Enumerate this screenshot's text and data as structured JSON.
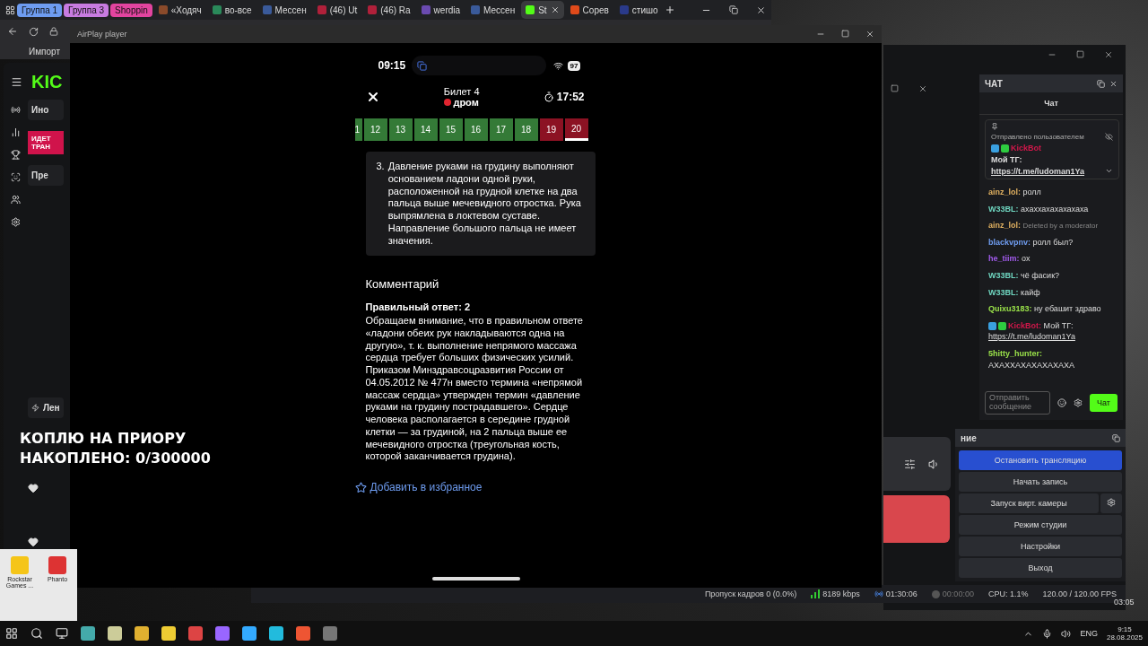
{
  "browser": {
    "tabs": [
      {
        "kind": "group",
        "label": "Группа 1",
        "color": "#6e9cf0"
      },
      {
        "kind": "group",
        "label": "Группа 3",
        "color": "#c77be0"
      },
      {
        "kind": "group",
        "label": "Shoppin",
        "color": "#e2449f"
      },
      {
        "kind": "page",
        "label": "«Ходяч",
        "selected": false
      },
      {
        "kind": "page",
        "label": "во-все",
        "selected": false
      },
      {
        "kind": "page",
        "label": "Мессен",
        "selected": false
      },
      {
        "kind": "page",
        "label": "(46) Ut",
        "selected": false
      },
      {
        "kind": "page",
        "label": "(46) Ra",
        "selected": false
      },
      {
        "kind": "page",
        "label": "werdia",
        "selected": false
      },
      {
        "kind": "page",
        "label": "Мессен",
        "selected": false
      },
      {
        "kind": "page",
        "label": "St",
        "selected": true
      },
      {
        "kind": "page",
        "label": "Сорев",
        "selected": false
      },
      {
        "kind": "page",
        "label": "стишо",
        "selected": false
      }
    ],
    "bookmark": "Импорт"
  },
  "kick_panel": {
    "logo": "KIC",
    "sections": [
      "Ино",
      "Пре",
      "Лен"
    ],
    "live_badge": [
      "ИДЕТ",
      "ТРАН"
    ]
  },
  "airplay": {
    "title": "AirPlay player",
    "phone": {
      "time": "09:15",
      "battery": "97",
      "ticket": "Билет 4",
      "brand": "дром",
      "timer": "17:52",
      "questions": [
        {
          "label": "1",
          "color": "#347a37",
          "selected": false
        },
        {
          "label": "12",
          "color": "#347a37",
          "selected": false
        },
        {
          "label": "13",
          "color": "#347a37",
          "selected": false
        },
        {
          "label": "14",
          "color": "#347a37",
          "selected": false
        },
        {
          "label": "15",
          "color": "#347a37",
          "selected": false
        },
        {
          "label": "16",
          "color": "#347a37",
          "selected": false
        },
        {
          "label": "17",
          "color": "#347a37",
          "selected": false
        },
        {
          "label": "18",
          "color": "#347a37",
          "selected": false
        },
        {
          "label": "19",
          "color": "#8c1223",
          "selected": false
        },
        {
          "label": "20",
          "color": "#8c1223",
          "selected": true
        }
      ],
      "option": {
        "number": "3.",
        "text": "Давление руками на грудину выполняют основанием ладони одной руки, расположенной на грудной клетке на два пальца выше мечевидного отростка. Рука выпрямлена в локтевом суставе. Направление большого пальца не имеет значения."
      },
      "comment_title": "Комментарий",
      "correct_answer": "Правильный ответ: 2",
      "comment": "Обращаем внимание, что в правильном ответе «ладони обеих рук накладываются одна на другую», т. к. выполнение непрямого массажа сердца требует больших физических усилий. Приказом Минздравсоцразвития России от 04.05.2012 № 477н вместо термина «непрямой массаж сердца» утвержден термин «давление руками на грудину пострадавшего». Сердце человека располагается в середине грудной клетки — за грудиной, на 2 пальца выше ее мечевидного отростка (треугольная кость, которой заканчивается грудина).",
      "favorite": "Добавить в избранное"
    }
  },
  "overlay": [
    "КОПЛЮ НА ПРИОРУ",
    "НАКОПЛЕНО: 0/300000"
  ],
  "chat": {
    "dock_title": "ЧАТ",
    "header": "Чат",
    "pinned": {
      "label": "Отправлено пользователем",
      "user": "KickBot",
      "text": "Мой ТГ:",
      "link": "https://t.me/ludoman1Ya"
    },
    "messages": [
      {
        "kind": "text",
        "user": "ainz_lol:",
        "color": "#e0b060",
        "text": "ролл"
      },
      {
        "kind": "text",
        "user": "W33BL:",
        "color": "#6fd6c0",
        "text": "ахаххахахахахаха"
      },
      {
        "kind": "deleted",
        "user": "ainz_lol:",
        "color": "#e0b060",
        "text": "Deleted by a moderator"
      },
      {
        "kind": "text",
        "user": "blackvpnv:",
        "color": "#6f9cf0",
        "text": "ролл был?"
      },
      {
        "kind": "text",
        "user": "he_tiim:",
        "color": "#a45cf0",
        "text": "ох"
      },
      {
        "kind": "text",
        "user": "W33BL:",
        "color": "#6fd6c0",
        "text": "чё фасик?"
      },
      {
        "kind": "text",
        "user": "W33BL:",
        "color": "#6fd6c0",
        "text": "кайф"
      },
      {
        "kind": "text",
        "user": "Quixu3183:",
        "color": "#9be34a",
        "text": "ну ебашит здраво"
      },
      {
        "kind": "bot",
        "user": "KickBot:",
        "color": "#d0174a",
        "text": "Мой ТГ:",
        "link": "https://t.me/ludoman1Ya"
      },
      {
        "kind": "text",
        "user": "5hitty_hunter:",
        "color": "#9be34a",
        "text": "АХАХХАХАХАХАХАХА"
      }
    ],
    "input_placeholder": "Отправить сообщение",
    "send": "Чат"
  },
  "controls": {
    "title": "ние",
    "buttons": [
      {
        "label": "Остановить трансляцию",
        "selected": true
      },
      {
        "label": "Начать запись",
        "selected": false
      },
      {
        "label": "Запуск вирт. камеры",
        "selected": false
      },
      {
        "label": "Режим студии",
        "selected": false
      },
      {
        "label": "Настройки",
        "selected": false
      },
      {
        "label": "Выход",
        "selected": false
      }
    ]
  },
  "status_bar": {
    "dropped": "Пропуск кадров 0 (0.0%)",
    "bitrate": "8189 kbps",
    "stream_time": "01:30:06",
    "record_time": "00:00:00",
    "cpu": "CPU: 1.1%",
    "fps": "120.00 / 120.00 FPS"
  },
  "video_time": "03:05",
  "desktop_icons": [
    "Rockstar Games ...",
    "Phanto"
  ],
  "taskbar": {
    "language": "ENG",
    "time": "9:15",
    "date": "28.08.2025"
  }
}
